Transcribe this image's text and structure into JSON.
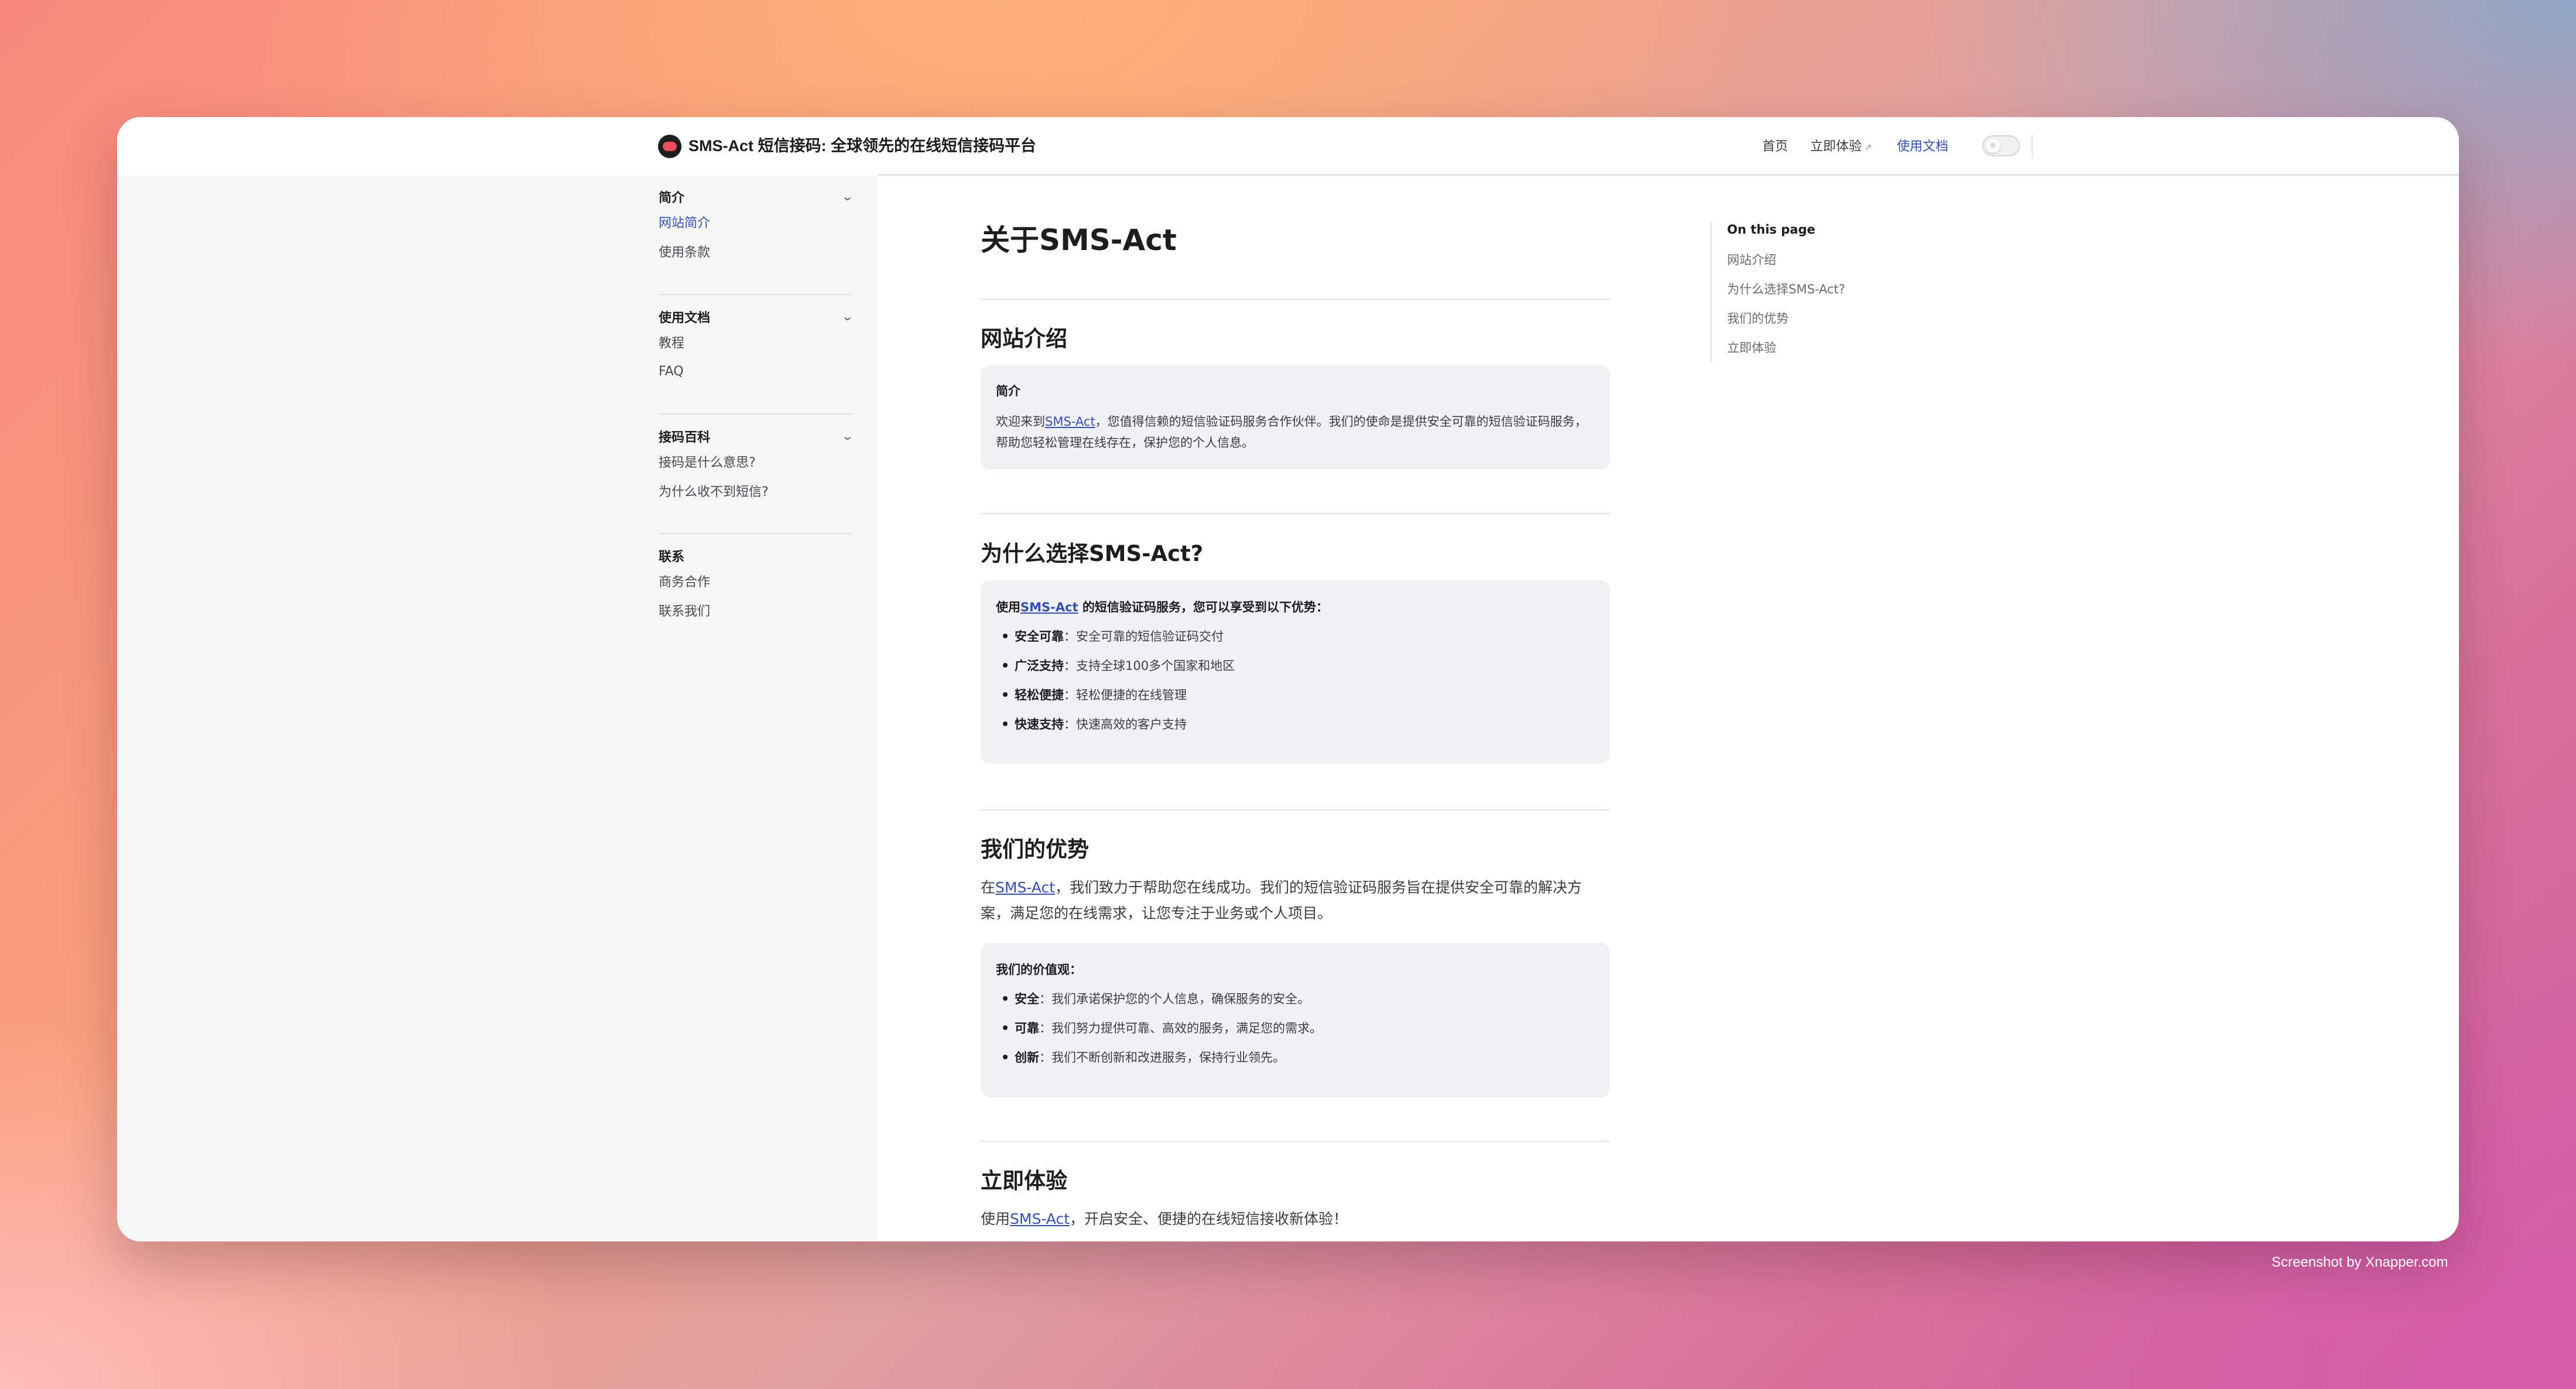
{
  "header": {
    "site_title": "SMS-Act 短信接码: 全球领先的在线短信接码平台",
    "nav": {
      "home": "首页",
      "try_now": "立即体验",
      "try_now_ext": "↗",
      "docs": "使用文档"
    },
    "theme_toggle_icon": "sun-icon"
  },
  "sidebar": {
    "groups": [
      {
        "title": "简介",
        "items": [
          "网站简介",
          "使用条款"
        ]
      },
      {
        "title": "使用文档",
        "items": [
          "教程",
          "FAQ"
        ]
      },
      {
        "title": "接码百科",
        "items": [
          "接码是什么意思?",
          "为什么收不到短信?"
        ]
      },
      {
        "title": "联系",
        "items": [
          "商务合作",
          "联系我们"
        ]
      }
    ],
    "active_item": "网站简介"
  },
  "content": {
    "h1": "关于SMS-Act",
    "sections": {
      "intro": {
        "heading": "网站介绍",
        "box_title": "简介",
        "text_before": "欢迎来到",
        "link": "SMS-Act",
        "text_after": "，您值得信赖的短信验证码服务合作伙伴。我们的使命是提供安全可靠的短信验证码服务，帮助您轻松管理在线存在，保护您的个人信息。"
      },
      "why": {
        "heading": "为什么选择SMS-Act?",
        "box_prefix": "使用",
        "box_link": "SMS-Act",
        "box_suffix": " 的短信验证码服务，您可以享受到以下优势：",
        "bullets": [
          {
            "label": "安全可靠",
            "text": "：安全可靠的短信验证码交付"
          },
          {
            "label": "广泛支持",
            "text": "：支持全球100多个国家和地区"
          },
          {
            "label": "轻松便捷",
            "text": "：轻松便捷的在线管理"
          },
          {
            "label": "快速支持",
            "text": "：快速高效的客户支持"
          }
        ]
      },
      "advantages": {
        "heading": "我们的优势",
        "para_prefix": "在",
        "para_link": "SMS-Act",
        "para_suffix": "，我们致力于帮助您在线成功。我们的短信验证码服务旨在提供安全可靠的解决方案，满足您的在线需求，让您专注于业务或个人项目。",
        "box_title": "我们的价值观：",
        "bullets": [
          {
            "label": "安全",
            "text": "：我们承诺保护您的个人信息，确保服务的安全。"
          },
          {
            "label": "可靠",
            "text": "：我们努力提供可靠、高效的服务，满足您的需求。"
          },
          {
            "label": "创新",
            "text": "：我们不断创新和改进服务，保持行业领先。"
          }
        ]
      },
      "try": {
        "heading": "立即体验",
        "para_prefix": "使用",
        "para_link": "SMS-Act",
        "para_suffix": "，开启安全、便捷的在线短信接收新体验！"
      }
    }
  },
  "aside": {
    "title": "On this page",
    "items": [
      "网站介绍",
      "为什么选择SMS-Act?",
      "我们的优势",
      "立即体验"
    ]
  },
  "credit": "Screenshot by Xnapper.com",
  "colors": {
    "accent": "#3451b2",
    "sidebar_bg": "#f6f6f7",
    "box_bg": "#f0f1f4"
  }
}
